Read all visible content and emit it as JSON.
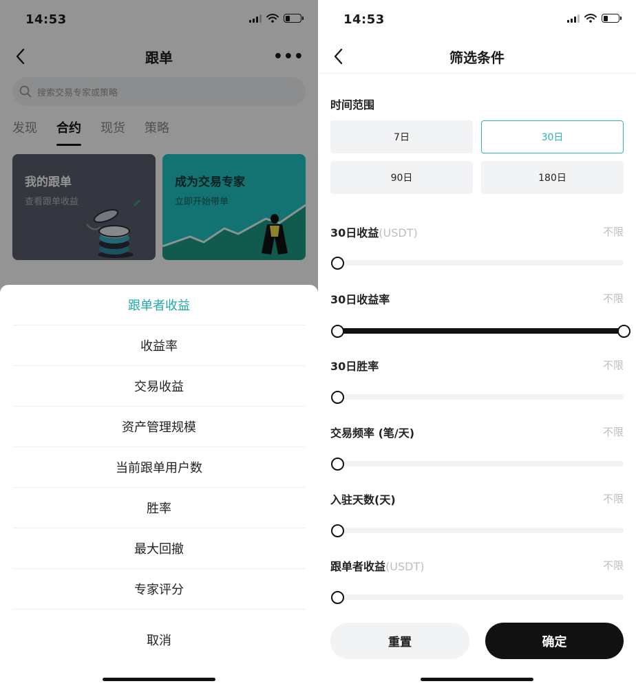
{
  "left_screen": {
    "status": {
      "time": "14:53"
    },
    "nav": {
      "title": "跟单",
      "more": "•••"
    },
    "search": {
      "placeholder": "搜索交易专家或策略"
    },
    "tabs": [
      "发现",
      "合约",
      "现货",
      "策略"
    ],
    "active_tab": "合约",
    "cards": [
      {
        "title": "我的跟单",
        "subtitle": "查看跟单收益"
      },
      {
        "title": "成为交易专家",
        "subtitle": "立即开始带单"
      }
    ],
    "sort_sheet": {
      "items": [
        "跟单者收益",
        "收益率",
        "交易收益",
        "资产管理规模",
        "当前跟单用户数",
        "胜率",
        "最大回撤",
        "专家评分"
      ],
      "selected": "跟单者收益",
      "cancel": "取消"
    }
  },
  "right_screen": {
    "status": {
      "time": "14:53"
    },
    "nav": {
      "title": "筛选条件"
    },
    "time_range": {
      "title": "时间范围",
      "options": [
        "7日",
        "30日",
        "90日",
        "180日"
      ],
      "selected": "30日"
    },
    "filters": [
      {
        "label": "30日收益",
        "unit": "(USDT)",
        "value": "不限",
        "range": [
          0,
          0
        ]
      },
      {
        "label": "30日收益率",
        "unit": "",
        "value": "不限",
        "range": [
          0,
          1
        ]
      },
      {
        "label": "30日胜率",
        "unit": "",
        "value": "不限",
        "range": [
          0,
          0
        ]
      },
      {
        "label": "交易频率 (笔/天)",
        "unit": "",
        "value": "不限",
        "range": [
          0,
          0
        ]
      },
      {
        "label": "入驻天数(天)",
        "unit": "",
        "value": "不限",
        "range": [
          0,
          0
        ]
      },
      {
        "label": "跟单者收益",
        "unit": "(USDT)",
        "value": "不限",
        "range": [
          0,
          0
        ]
      }
    ],
    "buttons": {
      "reset": "重置",
      "confirm": "确定"
    }
  },
  "colors": {
    "accent": "#25b7b7",
    "card_dark": "#5a5f6e",
    "card_teal": "#21c4c4",
    "primary_button": "#111111"
  }
}
